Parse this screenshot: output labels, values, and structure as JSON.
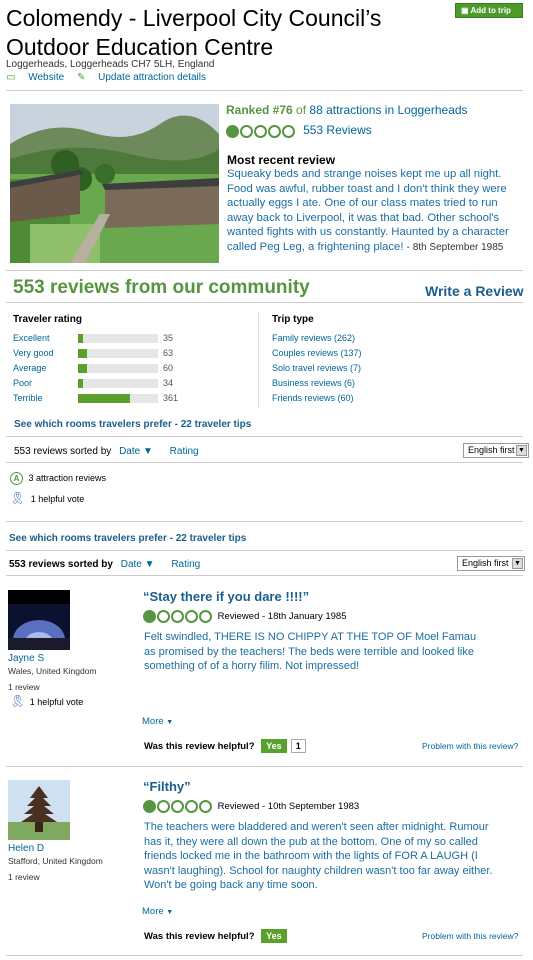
{
  "header": {
    "title": "Colomendy - Liverpool City Council’s Outdoor Education Centre",
    "add_to_trip": "Add to trip",
    "address": "Loggerheads, Loggerheads CH7 5LH, England",
    "website": "Website",
    "update": "Update attraction details"
  },
  "summary": {
    "ranked": "Ranked #76",
    "of": "of",
    "total": "88",
    "attractions_in": "attractions in Loggerheads",
    "rating_bubbles": 1,
    "reviews": "553 Reviews",
    "recent_heading": "Most recent review",
    "recent_text": "Squeaky beds and strange noises kept me up all night. Food was awful, rubber toast and I don't think they were actually eggs I ate. One of our class mates tried to run away back to Liverpool, it was that bad. Other school's wanted fights with us constantly. Haunted by a character called Peg Leg, a frightening place!",
    "recent_date": "- 8th September 1985"
  },
  "community": {
    "heading": "553 reviews from our community",
    "write_review": "Write a Review",
    "traveler_rating_label": "Traveler rating",
    "ratings": [
      {
        "label": "Excellent",
        "count": "35",
        "value": 35
      },
      {
        "label": "Very good",
        "count": "63",
        "value": 63
      },
      {
        "label": "Average",
        "count": "60",
        "value": 60
      },
      {
        "label": "Poor",
        "count": "34",
        "value": 34
      },
      {
        "label": "Terrible",
        "count": "361",
        "value": 361
      }
    ],
    "trip_type_label": "Trip type",
    "trip_types": [
      "Family reviews (262)",
      "Couples reviews (137)",
      "Solo travel reviews (7)",
      "Business reviews (6)",
      "Friends reviews (60)"
    ],
    "rooms_link": "See which rooms travelers prefer - 22 traveler tips"
  },
  "sort1": {
    "label": "553 reviews sorted by",
    "date": "Date",
    "rating": "Rating",
    "lang": "English first"
  },
  "badges": {
    "attraction_reviews": "3 attraction reviews",
    "helpful": "1 helpful vote"
  },
  "rooms_link2": "See which rooms travelers prefer - 22 traveler tips",
  "sort2": {
    "label": "553 reviews sorted by",
    "date": "Date",
    "rating": "Rating",
    "lang": "English first"
  },
  "reviews": [
    {
      "user": "Jayne S",
      "location": "Wales, United Kingdom",
      "count": "1 review",
      "helpful": "1 helpful vote",
      "title": "“Stay there if you dare !!!!”",
      "reviewed": "Reviewed - 18th January 1985",
      "bubbles": 1,
      "text": "Felt swindled, THERE IS NO CHIPPY AT THE TOP OF Moel Famau as promised by the teachers! The beds were terrible and looked like something of of a horry filim. Not impressed!",
      "more": "More",
      "helpful_q": "Was this review helpful?",
      "yes": "Yes",
      "yes_count": "1",
      "problem": "Problem with this review?"
    },
    {
      "user": "Helen D",
      "location": "Stafford, United Kingdom",
      "count": "1 review",
      "title": "“Filthy”",
      "reviewed": "Reviewed - 10th September 1983",
      "bubbles": 1,
      "text": "The teachers were bladdered and weren't seen after midnight. Rumour has it, they were all down the pub at the bottom. One of my so called friends locked me in the bathroom with the lights of FOR A LAUGH (I wasn't laughing). School for naughty children wasn't too far away either. Won't be going back any time soon.",
      "more": "More",
      "helpful_q": "Was this review helpful?",
      "yes": "Yes",
      "problem": "Problem with this review?"
    }
  ]
}
